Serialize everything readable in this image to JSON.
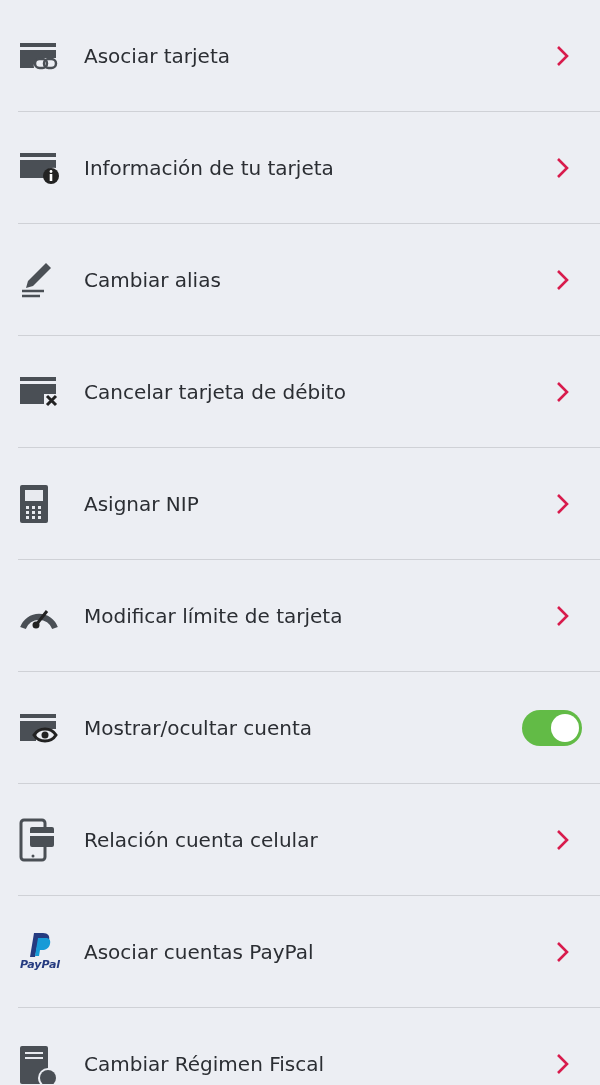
{
  "menu": [
    {
      "label": "Asociar tarjeta",
      "kind": "link"
    },
    {
      "label": "Información de tu tarjeta",
      "kind": "link"
    },
    {
      "label": "Cambiar alias",
      "kind": "link"
    },
    {
      "label": "Cancelar tarjeta de débito",
      "kind": "link"
    },
    {
      "label": "Asignar NIP",
      "kind": "link"
    },
    {
      "label": "Modificar límite de tarjeta",
      "kind": "link"
    },
    {
      "label": "Mostrar/ocultar cuenta",
      "kind": "toggle",
      "on": true
    },
    {
      "label": "Relación cuenta celular",
      "kind": "link"
    },
    {
      "label": "Asociar cuentas PayPal",
      "kind": "link",
      "logo_text": "PayPal"
    },
    {
      "label": "Cambiar Régimen Fiscal",
      "kind": "link"
    }
  ]
}
